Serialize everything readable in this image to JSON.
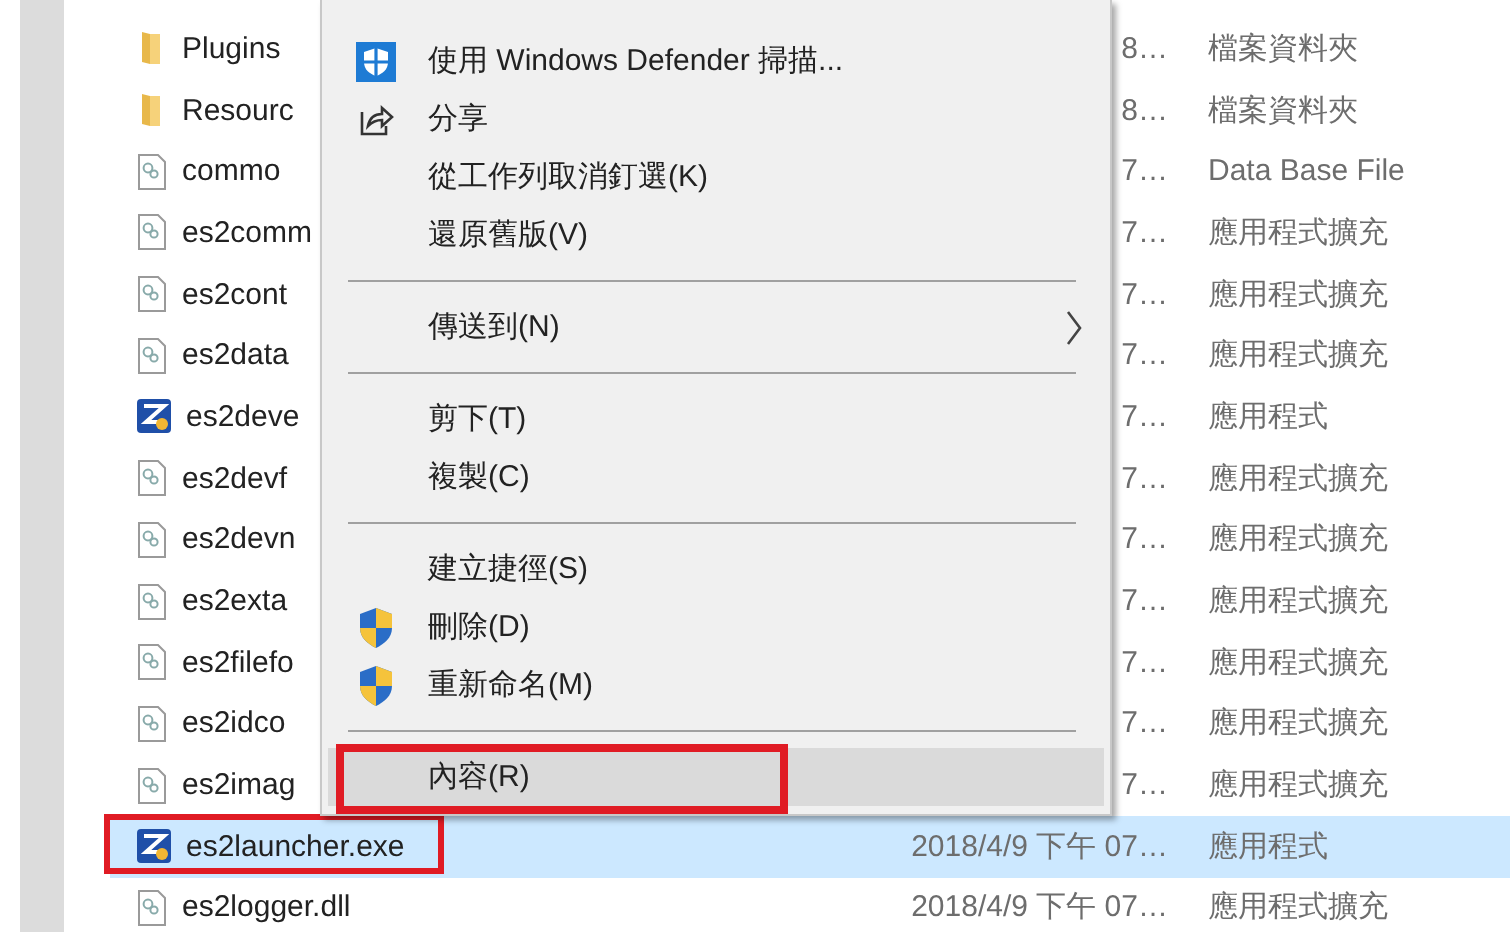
{
  "files": [
    {
      "name": "Plugins",
      "kind": "folder",
      "date": "8…",
      "type": "檔案資料夾",
      "selected": false,
      "annotated": false
    },
    {
      "name": "Resourc",
      "kind": "folder",
      "date": "8…",
      "type": "檔案資料夾",
      "selected": false,
      "annotated": false
    },
    {
      "name": "commo",
      "kind": "dll",
      "date": "7…",
      "type": "Data Base File",
      "selected": false,
      "annotated": false
    },
    {
      "name": "es2comm",
      "kind": "dll",
      "date": "7…",
      "type": "應用程式擴充",
      "selected": false,
      "annotated": false
    },
    {
      "name": "es2cont",
      "kind": "dll",
      "date": "7…",
      "type": "應用程式擴充",
      "selected": false,
      "annotated": false
    },
    {
      "name": "es2data",
      "kind": "dll",
      "date": "7…",
      "type": "應用程式擴充",
      "selected": false,
      "annotated": false
    },
    {
      "name": "es2deve",
      "kind": "app",
      "date": "7…",
      "type": "應用程式",
      "selected": false,
      "annotated": false
    },
    {
      "name": "es2devf",
      "kind": "dll",
      "date": "7…",
      "type": "應用程式擴充",
      "selected": false,
      "annotated": false
    },
    {
      "name": "es2devn",
      "kind": "dll",
      "date": "7…",
      "type": "應用程式擴充",
      "selected": false,
      "annotated": false
    },
    {
      "name": "es2exta",
      "kind": "dll",
      "date": "7…",
      "type": "應用程式擴充",
      "selected": false,
      "annotated": false
    },
    {
      "name": "es2filefo",
      "kind": "dll",
      "date": "7…",
      "type": "應用程式擴充",
      "selected": false,
      "annotated": false
    },
    {
      "name": "es2idco",
      "kind": "dll",
      "date": "7…",
      "type": "應用程式擴充",
      "selected": false,
      "annotated": false
    },
    {
      "name": "es2imag",
      "kind": "dll",
      "date": "7…",
      "type": "應用程式擴充",
      "selected": false,
      "annotated": false
    },
    {
      "name": "es2launcher.exe",
      "kind": "app",
      "date": "2018/4/9 下午 07…",
      "type": "應用程式",
      "selected": true,
      "annotated": true
    },
    {
      "name": "es2logger.dll",
      "kind": "dll",
      "date": "2018/4/9 下午 07…",
      "type": "應用程式擴充",
      "selected": false,
      "annotated": false
    }
  ],
  "context_menu": [
    {
      "kind": "scan",
      "label": "使用 Windows Defender 掃描...",
      "submenu": false,
      "selected": false,
      "annotated": false
    },
    {
      "kind": "share",
      "label": "分享",
      "submenu": false,
      "selected": false,
      "annotated": false
    },
    {
      "kind": "item",
      "label": "從工作列取消釘選(K)",
      "submenu": false,
      "selected": false,
      "annotated": false
    },
    {
      "kind": "item",
      "label": "還原舊版(V)",
      "submenu": false,
      "selected": false,
      "annotated": false
    },
    {
      "kind": "separator"
    },
    {
      "kind": "item",
      "label": "傳送到(N)",
      "submenu": true,
      "selected": false,
      "annotated": false
    },
    {
      "kind": "separator"
    },
    {
      "kind": "item",
      "label": "剪下(T)",
      "submenu": false,
      "selected": false,
      "annotated": false
    },
    {
      "kind": "item",
      "label": "複製(C)",
      "submenu": false,
      "selected": false,
      "annotated": false
    },
    {
      "kind": "separator"
    },
    {
      "kind": "item",
      "label": "建立捷徑(S)",
      "submenu": false,
      "selected": false,
      "annotated": false
    },
    {
      "kind": "elevated",
      "label": "刪除(D)",
      "submenu": false,
      "selected": false,
      "annotated": false
    },
    {
      "kind": "elevated",
      "label": "重新命名(M)",
      "submenu": false,
      "selected": false,
      "annotated": false
    },
    {
      "kind": "separator"
    },
    {
      "kind": "item",
      "label": "內容(R)",
      "submenu": false,
      "selected": true,
      "annotated": true
    }
  ]
}
